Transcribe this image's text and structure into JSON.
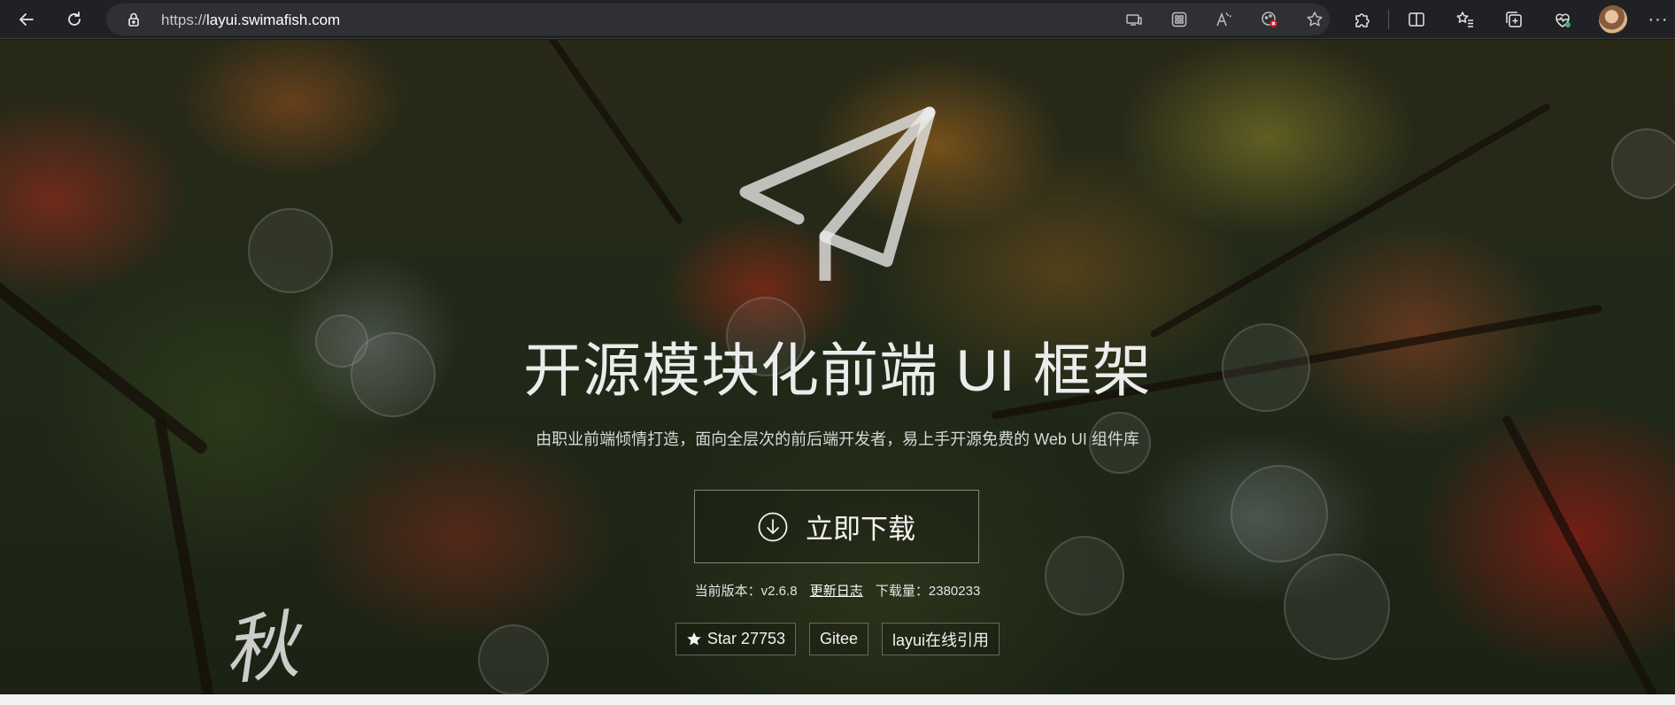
{
  "browser": {
    "url_scheme": "https://",
    "url_host": "layui.swimafish.com",
    "icons": {
      "back": "arrow-left-icon",
      "refresh": "refresh-icon",
      "lock": "lock-icon",
      "app_available": "app-available-icon",
      "apps": "apps-grid-icon",
      "read_aloud": "read-aloud-icon",
      "tracking": "tracking-prevention-icon",
      "favorite_add": "star-outline-icon",
      "extensions": "puzzle-icon",
      "split_screen": "split-screen-icon",
      "favorites": "favorites-icon",
      "collections": "collections-icon",
      "health": "browser-essentials-icon",
      "more": "more-dots-icon"
    }
  },
  "hero": {
    "title": "开源模块化前端 UI 框架",
    "subtitle": "由职业前端倾情打造，面向全层次的前后端开发者，易上手开源免费的 Web UI 组件库",
    "download_label": "立即下载",
    "version_label": "当前版本：v2.6.8",
    "changelog_label": "更新日志",
    "downloads_label": "下载量：2380233",
    "badges": {
      "star": "Star 27753",
      "gitee": "Gitee",
      "cdn": "layui在线引用"
    },
    "calligraphy": "秋"
  },
  "colors": {
    "toolbar_bg": "#202124",
    "address_bg": "#2f3033",
    "text_light": "#ececec"
  }
}
